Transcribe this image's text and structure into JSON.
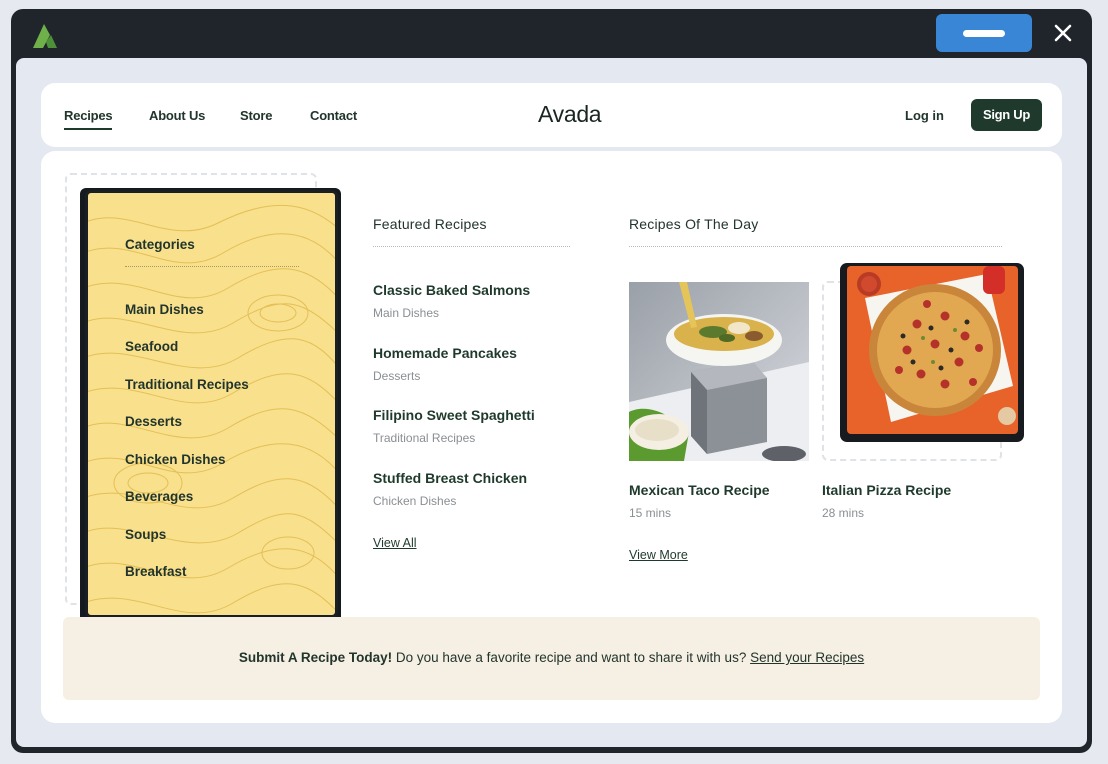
{
  "window": {
    "logo_icon": "avada-logo-icon",
    "action_icon": "minimize-bar-icon",
    "close_icon": "close-icon",
    "accent_color": "#3a86d6"
  },
  "nav": {
    "links": [
      "Recipes",
      "About Us",
      "Store",
      "Contact"
    ],
    "active": "Recipes",
    "brand": "Avada",
    "login": "Log in",
    "signup": "Sign Up",
    "brand_color": "#1f3a2c"
  },
  "categories": {
    "title": "Categories",
    "items": [
      "Main Dishes",
      "Seafood",
      "Traditional Recipes",
      "Desserts",
      "Chicken Dishes",
      "Beverages",
      "Soups",
      "Breakfast"
    ],
    "card_color": "#f9e08d"
  },
  "featured": {
    "title": "Featured Recipes",
    "items": [
      {
        "name": "Classic Baked Salmons",
        "category": "Main Dishes"
      },
      {
        "name": "Homemade Pancakes",
        "category": "Desserts"
      },
      {
        "name": "Filipino Sweet Spaghetti",
        "category": "Traditional Recipes"
      },
      {
        "name": "Stuffed Breast Chicken",
        "category": "Chicken Dishes"
      }
    ],
    "view_all": "View All"
  },
  "of_the_day": {
    "title": "Recipes Of The Day",
    "items": [
      {
        "name": "Mexican Taco Recipe",
        "time": "15 mins",
        "image": "soup-bowl-photo"
      },
      {
        "name": "Italian Pizza Recipe",
        "time": "28 mins",
        "image": "pizza-photo"
      }
    ],
    "view_more": "View More"
  },
  "banner": {
    "strong": "Submit A Recipe Today!",
    "text": "Do you have a favorite recipe and want to share it with us?",
    "link": "Send your Recipes",
    "color": "#f6efe4"
  }
}
